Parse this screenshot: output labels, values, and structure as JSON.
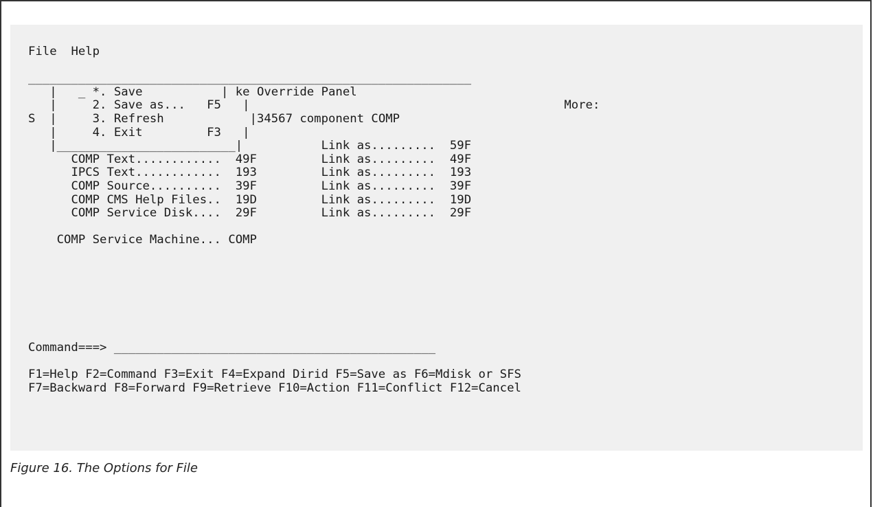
{
  "menubar": {
    "file": "File",
    "help": "Help"
  },
  "panel": {
    "top_rule": "______________________________________________________________",
    "title_fragment": " ke Override Panel",
    "more_label": "More:",
    "s_marker": "S",
    "component_line": "34567 component COMP"
  },
  "file_menu": {
    "selection_field": "_",
    "items": [
      {
        "label": "*. Save",
        "key": ""
      },
      {
        "label": "2. Save as...",
        "key": "F5"
      },
      {
        "label": "3. Refresh",
        "key": ""
      },
      {
        "label": "4. Exit",
        "key": "F3"
      }
    ],
    "bottom_rule": "_________________________"
  },
  "disks": {
    "first_link_value": "59F",
    "rows": [
      {
        "label": "COMP Text............",
        "value": "49F",
        "link_label": "Link as.........",
        "link_value": "49F"
      },
      {
        "label": "IPCS Text............",
        "value": "193",
        "link_label": "Link as.........",
        "link_value": "193"
      },
      {
        "label": "COMP Source..........",
        "value": "39F",
        "link_label": "Link as.........",
        "link_value": "39F"
      },
      {
        "label": "COMP CMS Help Files..",
        "value": "19D",
        "link_label": "Link as.........",
        "link_value": "19D"
      },
      {
        "label": "COMP Service Disk....",
        "value": "29F",
        "link_label": "Link as.........",
        "link_value": "29F"
      }
    ],
    "link_label": "Link as.........",
    "service_machine_label": "COMP Service Machine...",
    "service_machine_value": "COMP"
  },
  "command": {
    "prompt": "Command===>",
    "field": "_____________________________________________"
  },
  "function_keys": {
    "line1": "F1=Help F2=Command F3=Exit F4=Expand Dirid F5=Save as F6=Mdisk or SFS",
    "line2": "F7=Backward F8=Forward F9=Retrieve F10=Action F11=Conflict F12=Cancel"
  },
  "caption": "Figure 16. The Options for File"
}
